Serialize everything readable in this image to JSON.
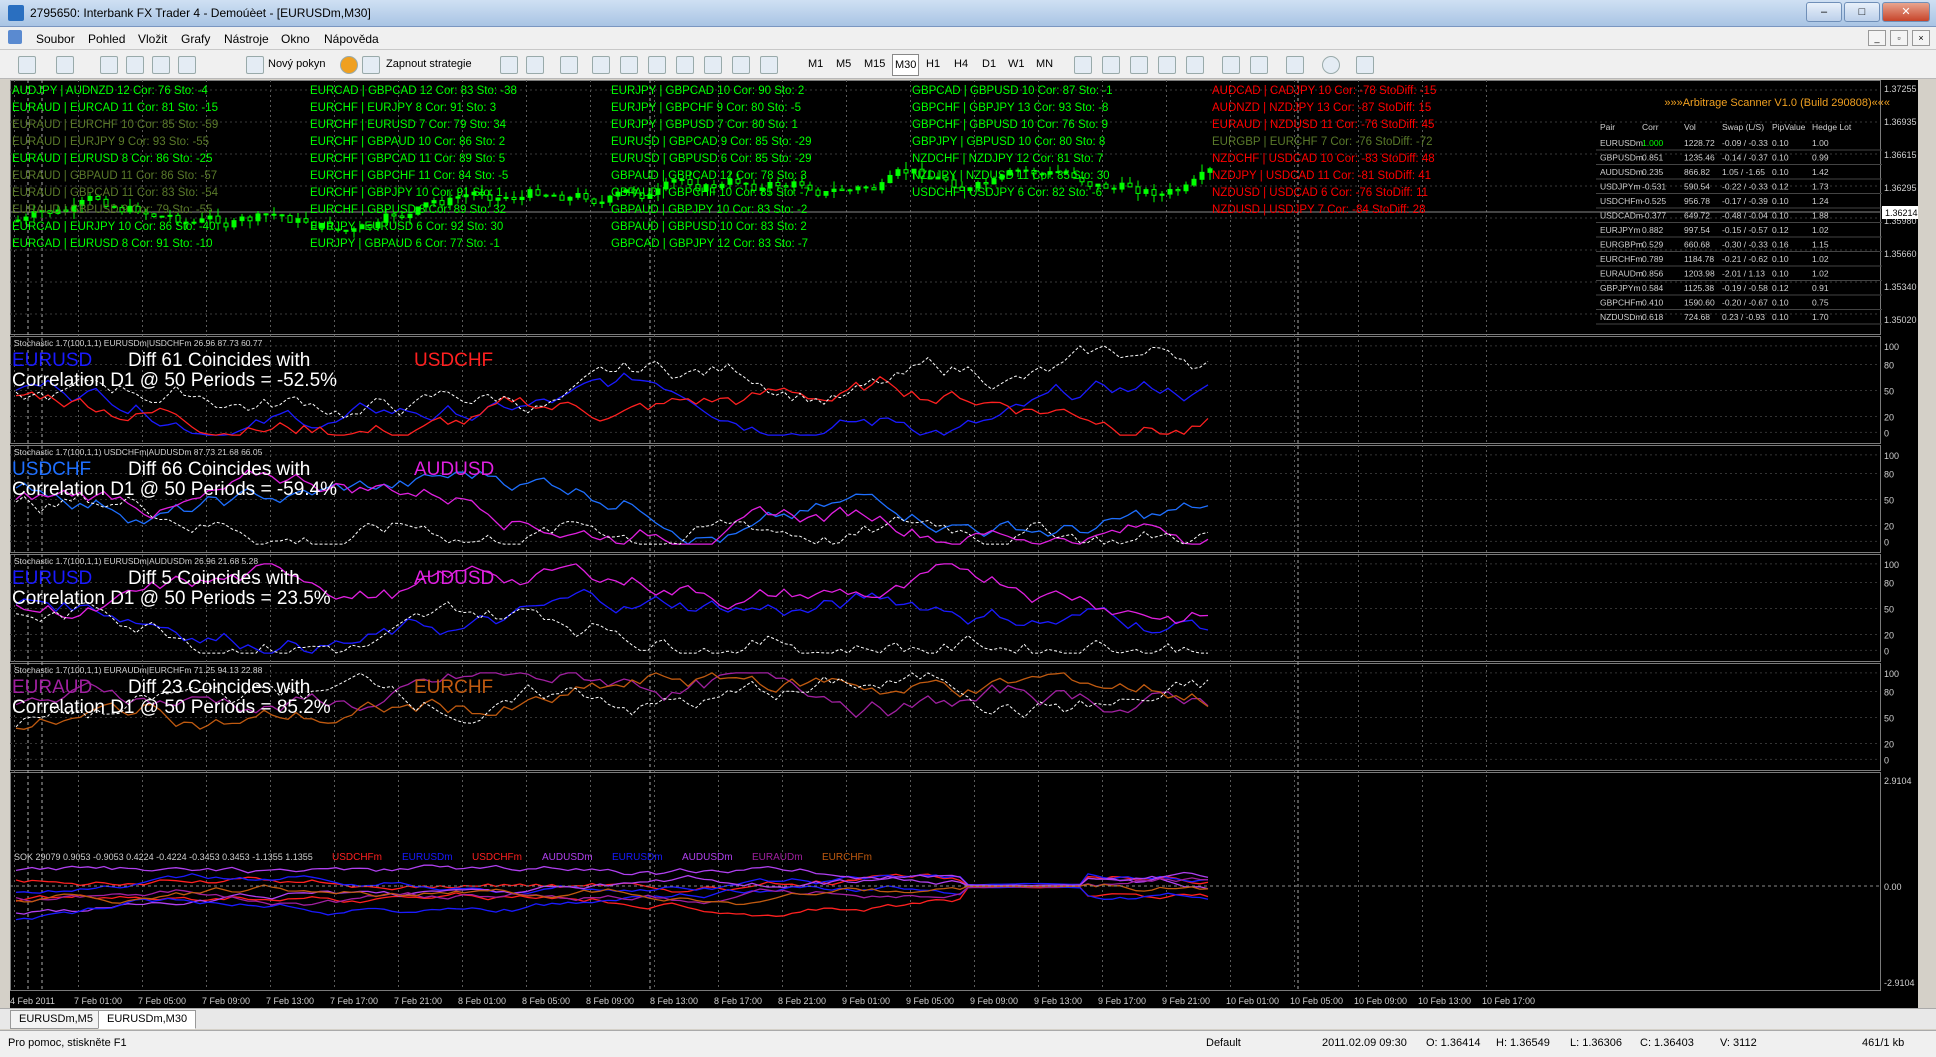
{
  "window": {
    "title": "2795650: Interbank FX Trader 4 - Demoúèet - [EURUSDm,M30]"
  },
  "menu": [
    "Soubor",
    "Pohled",
    "Vložit",
    "Grafy",
    "Nástroje",
    "Okno",
    "Nápověda"
  ],
  "toolbar": {
    "new_order": "Nový pokyn",
    "expert": "Zapnout strategie",
    "timeframes": [
      "M1",
      "M5",
      "M15",
      "M30",
      "H1",
      "H4",
      "D1",
      "W1",
      "MN"
    ]
  },
  "pairs_panel": {
    "col1": [
      {
        "t": "AUDJPY | AUDNZD  12   Cor: 76   Sto:  -4",
        "c": "#00ff00"
      },
      {
        "t": "EURAUD | EURCAD  11   Cor: 81   Sto: -15",
        "c": "#00ff00"
      },
      {
        "t": "EURAUD | EURCHF  10   Cor: 85   Sto: -59",
        "c": "#5a7a2a"
      },
      {
        "t": "EURAUD | EURJPY  9   Cor: 93   Sto: -55",
        "c": "#5a7a2a"
      },
      {
        "t": "EURAUD | EURUSD  8   Cor: 86   Sto: -25",
        "c": "#00ff00"
      },
      {
        "t": "EURAUD | GBPAUD  11   Cor: 86   Sto: -57",
        "c": "#5a7a2a"
      },
      {
        "t": "EURAUD | GBPCAD  11   Cor: 83   Sto: -54",
        "c": "#5a7a2a"
      },
      {
        "t": "EURAUD | GBPUSD  9   Cor: 79   Sto: -55",
        "c": "#5a7a2a"
      },
      {
        "t": "EURCAD | EURJPY  10   Cor: 86   Sto: -40",
        "c": "#00ff00"
      },
      {
        "t": "EURCAD | EURUSD  8   Cor: 91   Sto: -10",
        "c": "#00ff00"
      }
    ],
    "col2": [
      {
        "t": "EURCAD | GBPCAD  12   Cor: 83   Sto: -38",
        "c": "#00ff00"
      },
      {
        "t": "EURCHF | EURJPY  8   Cor: 91   Sto:  3",
        "c": "#00ff00"
      },
      {
        "t": "EURCHF | EURUSD  7   Cor: 79   Sto: 34",
        "c": "#00ff00"
      },
      {
        "t": "EURCHF | GBPAUD  10   Cor: 86   Sto:  2",
        "c": "#00ff00"
      },
      {
        "t": "EURCHF | GBPCAD  11   Cor: 89   Sto:  5",
        "c": "#00ff00"
      },
      {
        "t": "EURCHF | GBPCHF  11   Cor: 84   Sto: -5",
        "c": "#00ff00"
      },
      {
        "t": "EURCHF | GBPJPY  10   Cor: 91   Sto:  1",
        "c": "#00ff00"
      },
      {
        "t": "EURCHF | GBPUSD  8   Cor: 89   Sto: 32",
        "c": "#00ff00"
      },
      {
        "t": "EURJPY | EURUSD  6   Cor: 92   Sto: 30",
        "c": "#00ff00"
      },
      {
        "t": "EURJPY | GBPAUD  6   Cor: 77   Sto: -1",
        "c": "#00ff00"
      }
    ],
    "col3": [
      {
        "t": "EURJPY | GBPCAD  10   Cor: 90   Sto:  2",
        "c": "#00ff00"
      },
      {
        "t": "EURJPY | GBPCHF  9   Cor: 80   Sto: -5",
        "c": "#00ff00"
      },
      {
        "t": "EURJPY | GBPUSD  7   Cor: 80   Sto:  1",
        "c": "#00ff00"
      },
      {
        "t": "EURUSD | GBPCAD  9   Cor: 85   Sto: -29",
        "c": "#00ff00"
      },
      {
        "t": "EURUSD | GBPUSD  6   Cor: 85   Sto: -29",
        "c": "#00ff00"
      },
      {
        "t": "GBPAUD | GBPCAD  12   Cor: 78   Sto:  3",
        "c": "#00ff00"
      },
      {
        "t": "GBPAUD | GBPCHF  10   Cor: 85   Sto: -7",
        "c": "#00ff00"
      },
      {
        "t": "GBPAUD | GBPJPY  10   Cor: 83   Sto: -2",
        "c": "#00ff00"
      },
      {
        "t": "GBPAUD | GBPUSD  10   Cor: 83   Sto:  2",
        "c": "#00ff00"
      },
      {
        "t": "GBPCAD | GBPJPY  12   Cor: 83   Sto: -7",
        "c": "#00ff00"
      }
    ],
    "col4": [
      {
        "t": "GBPCAD | GBPUSD  10   Cor: 87   Sto: -1",
        "c": "#00ff00"
      },
      {
        "t": "GBPCHF | GBPJPY  13   Cor: 93   Sto: -8",
        "c": "#00ff00"
      },
      {
        "t": "GBPCHF | GBPUSD  10   Cor: 76   Sto:  9",
        "c": "#00ff00"
      },
      {
        "t": "GBPJPY | GBPUSD  10   Cor: 80   Sto:  8",
        "c": "#00ff00"
      },
      {
        "t": "NZDCHF | NZDJPY  12   Cor: 81   Sto:  7",
        "c": "#00ff00"
      },
      {
        "t": "NZDJPY | NZDUSD  11   Cor: 85   Sto: 30",
        "c": "#00ff00"
      },
      {
        "t": "USDCHF | USDJPY  6   Cor: 82   Sto: -6",
        "c": "#00ff00"
      }
    ],
    "col5": [
      {
        "t": "AUDCAD | CADJPY  10   Cor: -78   StoDiff: -15",
        "c": "#ff0000"
      },
      {
        "t": "AUDNZD | NZDJPY  13   Cor: -87   StoDiff: 15",
        "c": "#ff0000"
      },
      {
        "t": "EURAUD | NZDUSD  11   Cor: -76   StoDiff: 45",
        "c": "#ff0000"
      },
      {
        "t": "EURGBP | EURCHF  7   Cor: -76   StoDiff: -72",
        "c": "#5a7a2a"
      },
      {
        "t": "NZDCHF | USDCAD  10   Cor: -83   StoDiff: 48",
        "c": "#ff0000"
      },
      {
        "t": "NZDJPY | USDCAD  11   Cor: -81   StoDiff: 41",
        "c": "#ff0000"
      },
      {
        "t": "NZDUSD | USDCAD  6   Cor: -76   StoDiff: 11",
        "c": "#ff0000"
      },
      {
        "t": "NZDUSD | USDJPY  7   Cor: -84   StoDiff: 28",
        "c": "#ff0000"
      }
    ]
  },
  "scanner": {
    "title": "»»»Arbitrage Scanner   V1.0 (Build 290808)«««",
    "headers": [
      "Pair",
      "Corr",
      "Vol",
      "Swap (L/S)",
      "PipValue",
      "Hedge Lot"
    ],
    "rows": [
      [
        "EURUSDm",
        "1.000",
        "1228.72",
        "-0.09 / -0.33",
        "0.10",
        "1.00"
      ],
      [
        "GBPUSDm",
        "0.851",
        "1235.46",
        "-0.14 / -0.37",
        "0.10",
        "0.99"
      ],
      [
        "AUDUSDm",
        "0.235",
        "866.82",
        "1.05 / -1.65",
        "0.10",
        "1.42"
      ],
      [
        "USDJPYm",
        "-0.531",
        "590.54",
        "-0.22 / -0.33",
        "0.12",
        "1.73"
      ],
      [
        "USDCHFm",
        "-0.525",
        "956.78",
        "-0.17 / -0.39",
        "0.10",
        "1.24"
      ],
      [
        "USDCADm",
        "-0.377",
        "649.72",
        "-0.48 / -0.04",
        "0.10",
        "1.88"
      ],
      [
        "EURJPYm",
        "0.882",
        "997.54",
        "-0.15 / -0.57",
        "0.12",
        "1.02"
      ],
      [
        "EURGBPm",
        "0.529",
        "660.68",
        "-0.30 / -0.33",
        "0.16",
        "1.15"
      ],
      [
        "EURCHFm",
        "0.789",
        "1184.78",
        "-0.21 / -0.62",
        "0.10",
        "1.02"
      ],
      [
        "EURAUDm",
        "0.856",
        "1203.98",
        "-2.01 / 1.13",
        "0.10",
        "1.02"
      ],
      [
        "GBPJPYm",
        "0.584",
        "1125.38",
        "-0.19 / -0.58",
        "0.12",
        "0.91"
      ],
      [
        "GBPCHFm",
        "0.410",
        "1590.60",
        "-0.20 / -0.67",
        "0.10",
        "0.75"
      ],
      [
        "NZDUSDm",
        "0.618",
        "724.68",
        "0.23 / -0.93",
        "0.10",
        "1.70"
      ]
    ]
  },
  "price_axis": [
    "1.37255",
    "1.36935",
    "1.36615",
    "1.36295",
    "1.35980",
    "1.35660",
    "1.35340",
    "1.35020"
  ],
  "current_price": "1.36214",
  "subwindows": [
    {
      "header": "Stochastic 1.7(100,1,1) EURUSDm|USDCHFm 26.96 87.73 60.77",
      "sym1": "EURUSD",
      "sym2": "USDCHF",
      "c1": "#1a1aff",
      "c2": "#ff2020",
      "diff": "Diff 61 Coincides with",
      "corr": "Correlation D1 @ 50 Periods = -52.5%"
    },
    {
      "header": "Stochastic 1.7(100,1,1) USDCHFm|AUDUSDm 87.73 21.68 66.05",
      "sym1": "USDCHF",
      "sym2": "AUDUSD",
      "c1": "#1e6fff",
      "c2": "#e020e0",
      "diff": "Diff 66 Coincides with",
      "corr": "Correlation D1 @ 50 Periods = -59.4%"
    },
    {
      "header": "Stochastic 1.7(100,1,1) EURUSDm|AUDUSDm 26.96 21.68 5.28",
      "sym1": "EURUSD",
      "sym2": "AUDUSD",
      "c1": "#1a1aff",
      "c2": "#e020e0",
      "diff": "Diff 5 Coincides with",
      "corr": "Correlation D1 @ 50 Periods = 23.5%"
    },
    {
      "header": "Stochastic 1.7(100,1,1) EURAUDm|EURCHFm 71.25 94.13 22.88",
      "sym1": "EURAUD",
      "sym2": "EURCHF",
      "c1": "#a020a0",
      "c2": "#c05a10",
      "diff": "Diff 23 Coincides with",
      "corr": "Correlation D1 @ 50 Periods = 85.2%"
    }
  ],
  "stoch_axis": [
    "100",
    "80",
    "50",
    "20",
    "0"
  ],
  "sok": {
    "header": "SOK 29079 0.9053 -0.9053 0.4224 -0.4224 -0.3453 0.3453 -1.1355 1.1355",
    "legend": [
      {
        "t": "USDCHFm",
        "c": "#ff2020"
      },
      {
        "t": "EURUSDm",
        "c": "#1a1aff"
      },
      {
        "t": "USDCHFm",
        "c": "#ff2020"
      },
      {
        "t": "AUDUSDm",
        "c": "#b040f0"
      },
      {
        "t": "EURUSDm",
        "c": "#1a1aff"
      },
      {
        "t": "AUDUSDm",
        "c": "#b040f0"
      },
      {
        "t": "EURAUDm",
        "c": "#a020a0"
      },
      {
        "t": "EURCHFm",
        "c": "#c05a10"
      }
    ],
    "axis": [
      "2.9104",
      "0.00",
      "-2.9104"
    ]
  },
  "time_axis": [
    "4 Feb 2011",
    "7 Feb 01:00",
    "7 Feb 05:00",
    "7 Feb 09:00",
    "7 Feb 13:00",
    "7 Feb 17:00",
    "7 Feb 21:00",
    "8 Feb 01:00",
    "8 Feb 05:00",
    "8 Feb 09:00",
    "8 Feb 13:00",
    "8 Feb 17:00",
    "8 Feb 21:00",
    "9 Feb 01:00",
    "9 Feb 05:00",
    "9 Feb 09:00",
    "9 Feb 13:00",
    "9 Feb 17:00",
    "9 Feb 21:00",
    "10 Feb 01:00",
    "10 Feb 05:00",
    "10 Feb 09:00",
    "10 Feb 13:00",
    "10 Feb 17:00"
  ],
  "tabs": [
    "EURUSDm,M5",
    "EURUSDm,M30"
  ],
  "status": {
    "help": "Pro pomoc, stiskněte F1",
    "profile": "Default",
    "time": "2011.02.09 09:30",
    "open": "O: 1.36414",
    "high": "H: 1.36549",
    "low": "L: 1.36306",
    "close": "C: 1.36403",
    "volume": "V: 3112",
    "traffic": "461/1 kb"
  }
}
